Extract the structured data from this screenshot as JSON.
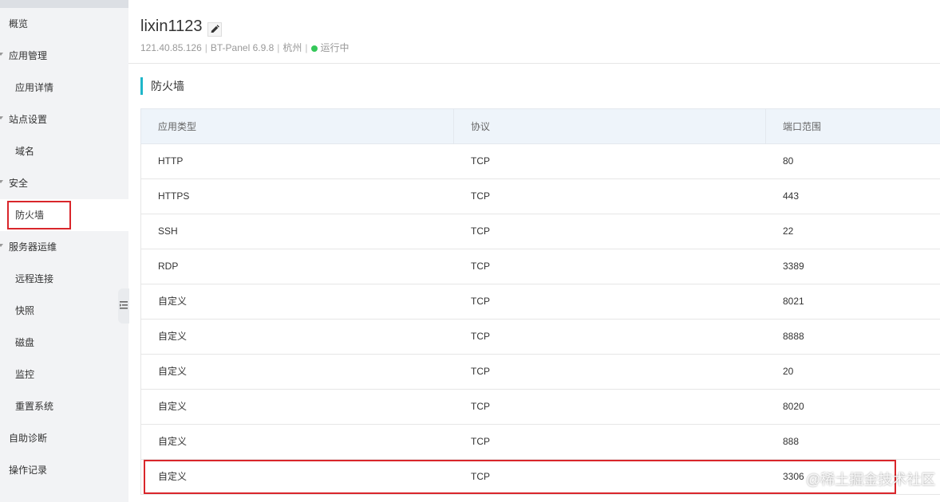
{
  "sidebar": {
    "items": [
      {
        "label": "概览",
        "level": "section",
        "caret": false
      },
      {
        "label": "应用管理",
        "level": "section",
        "caret": true
      },
      {
        "label": "应用详情",
        "level": "sub",
        "caret": false
      },
      {
        "label": "站点设置",
        "level": "section",
        "caret": true
      },
      {
        "label": "域名",
        "level": "sub",
        "caret": false
      },
      {
        "label": "安全",
        "level": "section",
        "caret": true
      },
      {
        "label": "防火墙",
        "level": "sub",
        "caret": false,
        "active": true
      },
      {
        "label": "服务器运维",
        "level": "section",
        "caret": true
      },
      {
        "label": "远程连接",
        "level": "sub",
        "caret": false
      },
      {
        "label": "快照",
        "level": "sub",
        "caret": false
      },
      {
        "label": "磁盘",
        "level": "sub",
        "caret": false
      },
      {
        "label": "监控",
        "level": "sub",
        "caret": false
      },
      {
        "label": "重置系统",
        "level": "sub",
        "caret": false
      },
      {
        "label": "自助诊断",
        "level": "section",
        "caret": false
      },
      {
        "label": "操作记录",
        "level": "section",
        "caret": false
      }
    ]
  },
  "header": {
    "instance_name": "lixin1123",
    "ip": "121.40.85.126",
    "image": "BT-Panel 6.9.8",
    "region": "杭州",
    "status": "运行中",
    "status_color": "#34c759"
  },
  "firewall": {
    "title": "防火墙",
    "accent_color": "#1fb6c9",
    "columns": [
      "应用类型",
      "协议",
      "端口范围"
    ],
    "rows": [
      [
        "HTTP",
        "TCP",
        "80"
      ],
      [
        "HTTPS",
        "TCP",
        "443"
      ],
      [
        "SSH",
        "TCP",
        "22"
      ],
      [
        "RDP",
        "TCP",
        "3389"
      ],
      [
        "自定义",
        "TCP",
        "8021"
      ],
      [
        "自定义",
        "TCP",
        "8888"
      ],
      [
        "自定义",
        "TCP",
        "20"
      ],
      [
        "自定义",
        "TCP",
        "8020"
      ],
      [
        "自定义",
        "TCP",
        "888"
      ],
      [
        "自定义",
        "TCP",
        "3306"
      ]
    ]
  },
  "highlight_color": "#d9262b",
  "watermark": "@稀土掘金技术社区"
}
